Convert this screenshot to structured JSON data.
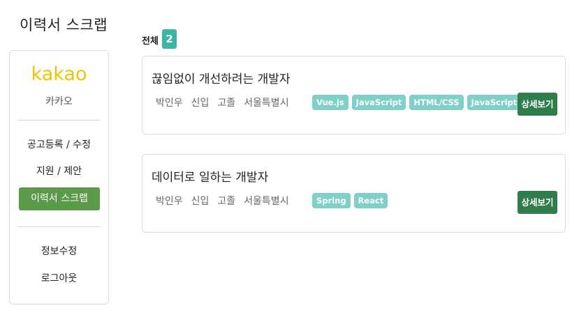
{
  "page": {
    "title": "이력서 스크랩"
  },
  "sidebar": {
    "company_logo_text": "kakao",
    "company_name": "카카오",
    "menu": [
      {
        "label": "공고등록 / 수정"
      },
      {
        "label": "지원 / 제안"
      },
      {
        "label": "이력서 스크랩",
        "active": true
      },
      {
        "label": "정보수정"
      },
      {
        "label": "로그아웃"
      }
    ]
  },
  "summary": {
    "total_label": "전체",
    "total_count": "2"
  },
  "resumes": [
    {
      "title": "끊임없이 개선하려는 개발자",
      "name": "박인우",
      "career": "신입",
      "education": "고졸",
      "location": "서울특별시",
      "skills": [
        "Vue.js",
        "JavaScript",
        "HTML/CSS",
        "JavaScript"
      ],
      "detail_label": "상세보기"
    },
    {
      "title": "데이터로 일하는 개발자",
      "name": "박인우",
      "career": "신입",
      "education": "고졸",
      "location": "서울특별시",
      "skills": [
        "Spring",
        "React"
      ],
      "detail_label": "상세보기"
    }
  ],
  "colors": {
    "logo": "#f2c300",
    "active_menu": "#5b9a49",
    "count_badge": "#3bb5a6",
    "skill_tag": "#7fd0c8",
    "detail_button": "#2f7d4a"
  }
}
